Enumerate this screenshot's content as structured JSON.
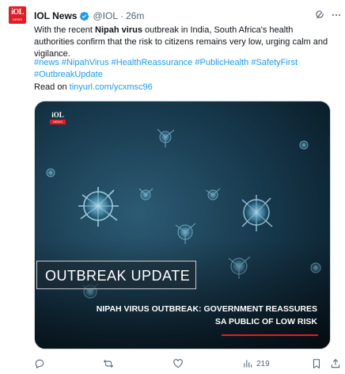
{
  "tweet": {
    "author_name": "IOL News",
    "handle": "@IOL",
    "separator": "·",
    "time": "26m",
    "avatar_logo": "iOL",
    "avatar_sub": "NEWS",
    "text_before_bold": "With the recent ",
    "text_bold": "Nipah virus",
    "text_after_bold": " outbreak in India, South Africa's health authorities confirm that the risk to citizens remains very low, urging calm and vigilance.",
    "hashtags_line1": "#news #NipahVirus #HealthReassurance #PublicHealth #SafetyFirst",
    "hashtags_line2": "#OutbreakUpdate",
    "read_on_label": "Read on ",
    "link": "tinyurl.com/ycxmsc96"
  },
  "media": {
    "logo_text": "iOL",
    "logo_sub": "NEWS",
    "badge_text": "OUTBREAK UPDATE",
    "headline_line1": "NIPAH VIRUS OUTBREAK: GOVERNMENT REASSURES",
    "headline_line2": "SA PUBLIC OF LOW RISK",
    "accent_color": "#e41b23"
  },
  "actions": {
    "reply_icon": "reply-icon",
    "retweet_icon": "retweet-icon",
    "like_icon": "like-icon",
    "views_icon": "views-icon",
    "views_count": "219",
    "bookmark_icon": "bookmark-icon",
    "share_icon": "share-icon"
  },
  "colors": {
    "link": "#1d9bf0",
    "muted": "#536471",
    "brand_red": "#e41b23"
  }
}
